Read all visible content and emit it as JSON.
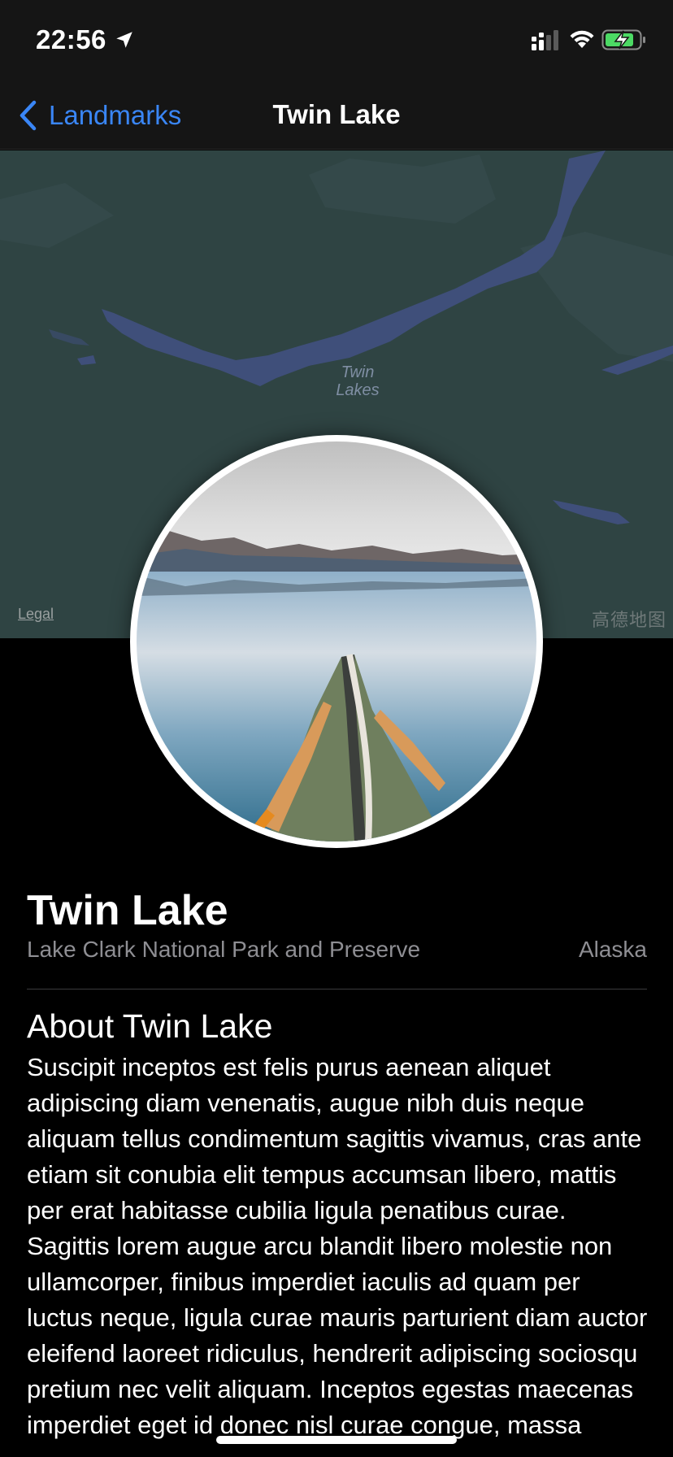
{
  "status_bar": {
    "time": "22:56"
  },
  "nav": {
    "back_label": "Landmarks",
    "title": "Twin Lake"
  },
  "map": {
    "place_label_line1": "Twin",
    "place_label_line2": "Lakes",
    "legal": "Legal",
    "provider_logo": "高德地图"
  },
  "landmark": {
    "name": "Twin Lake",
    "park": "Lake Clark National Park and Preserve",
    "state": "Alaska",
    "about_title": "About Twin Lake",
    "about_text": "Suscipit inceptos est felis purus aenean aliquet adipiscing diam venenatis, augue nibh duis neque aliquam tellus condimentum sagittis vivamus, cras ante etiam sit conubia elit tempus accumsan libero, mattis per erat habitasse cubilia ligula penatibus curae. Sagittis lorem augue arcu blandit libero molestie non ullamcorper, finibus imperdiet iaculis ad quam per luctus neque, ligula curae mauris parturient diam auctor eleifend laoreet ridiculus, hendrerit adipiscing sociosqu pretium nec velit aliquam. Inceptos egestas maecenas imperdiet eget id donec nisl curae congue, massa"
  },
  "colors": {
    "accent": "#3a86f6",
    "map_land": "#2f4443",
    "map_water": "#3f4f7a",
    "secondary_text": "#8e8e93"
  },
  "icons": {
    "location": "location-arrow-icon",
    "signal": "cellular-signal-icon",
    "wifi": "wifi-icon",
    "battery": "battery-charging-icon",
    "back": "chevron-left-icon"
  }
}
